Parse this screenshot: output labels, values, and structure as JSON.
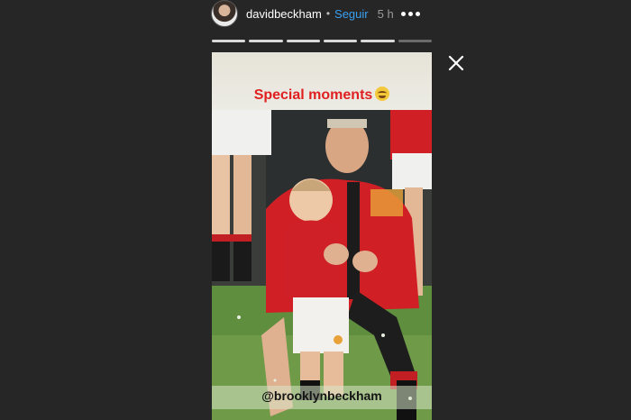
{
  "header": {
    "username": "davidbeckham",
    "separator": "•",
    "follow_label": "Seguir",
    "time": "5 h",
    "more_icon": "more-dots-icon",
    "avatar_icon": "profile-avatar"
  },
  "progress": {
    "segments_total": 6,
    "segments_viewed": 5
  },
  "close": {
    "icon": "close-icon"
  },
  "story": {
    "caption": "Special moments",
    "caption_emoji": "laughing-crying-emoji",
    "mention": "@brooklynbeckham"
  },
  "colors": {
    "background": "#262626",
    "caption_red": "#e02020",
    "follow_blue": "#3aa0f2",
    "pitch_green": "#5f8f3e",
    "kit_red": "#d01f25"
  }
}
